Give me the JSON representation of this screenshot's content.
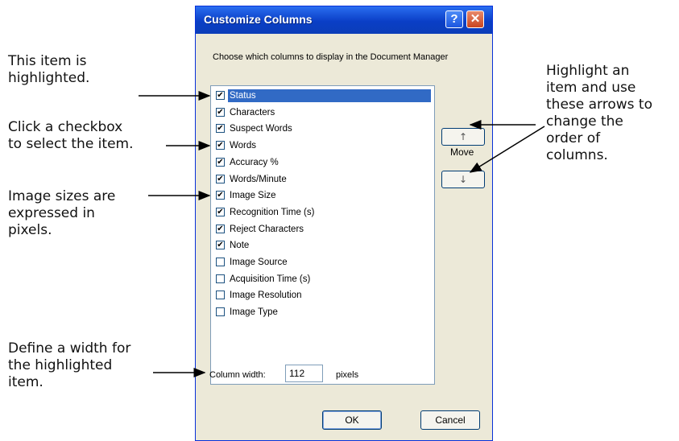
{
  "dialog": {
    "title": "Customize Columns",
    "help_glyph": "?",
    "close_glyph": "✕",
    "instruction": "Choose which columns to display in the Document Manager",
    "columns": [
      {
        "label": "Status",
        "checked": true,
        "selected": true
      },
      {
        "label": "Characters",
        "checked": true
      },
      {
        "label": "Suspect Words",
        "checked": true
      },
      {
        "label": "Words",
        "checked": true
      },
      {
        "label": "Accuracy %",
        "checked": true
      },
      {
        "label": "Words/Minute",
        "checked": true
      },
      {
        "label": "Image Size",
        "checked": true
      },
      {
        "label": "Recognition Time (s)",
        "checked": true
      },
      {
        "label": "Reject Characters",
        "checked": true
      },
      {
        "label": "Note",
        "checked": true
      },
      {
        "label": "Image Source",
        "checked": false
      },
      {
        "label": "Acquisition Time (s)",
        "checked": false
      },
      {
        "label": "Image Resolution",
        "checked": false
      },
      {
        "label": "Image Type",
        "checked": false
      }
    ],
    "move_label": "Move",
    "move_up_glyph": "↑",
    "move_down_glyph": "↓",
    "column_width_label": "Column width:",
    "column_width_value": "112",
    "column_width_unit": "pixels",
    "ok_label": "OK",
    "cancel_label": "Cancel"
  },
  "annotations": {
    "highlighted": "This item is\nhighlighted.",
    "checkbox": "Click a checkbox\nto select the item.",
    "image_sizes": "Image sizes are\nexpressed in\npixels.",
    "width": "Define a width for\nthe highlighted\nitem.",
    "arrows": "Highlight an\nitem and use\nthese arrows to\nchange the\norder of\ncolumns."
  },
  "colors": {
    "titlebar": "#0a3ec6",
    "selection": "#316ac5",
    "dialog_face": "#ece9d8"
  }
}
